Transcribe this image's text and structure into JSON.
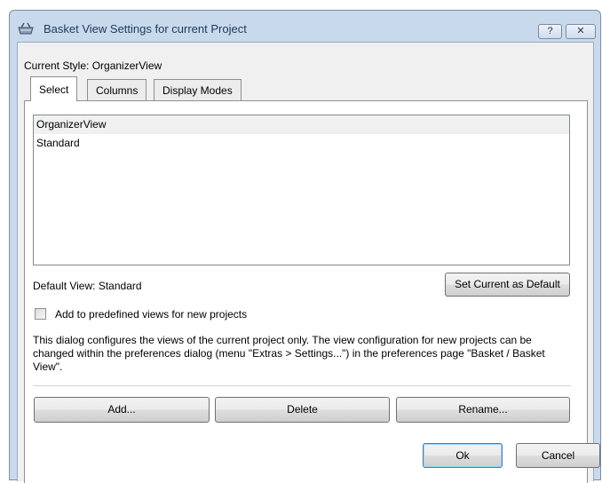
{
  "window": {
    "title": "Basket View Settings for current Project",
    "help_glyph": "?",
    "close_glyph": "✕"
  },
  "current_style": {
    "label": "Current Style:",
    "value": "OrganizerView"
  },
  "tabs": [
    {
      "label": "Select",
      "active": true
    },
    {
      "label": "Columns",
      "active": false
    },
    {
      "label": "Display Modes",
      "active": false
    }
  ],
  "views_list": [
    {
      "label": "OrganizerView",
      "selected": true
    },
    {
      "label": "Standard",
      "selected": false
    }
  ],
  "default_view": {
    "label": "Default View:",
    "value": "Standard"
  },
  "set_default_button": "Set Current as Default",
  "checkbox": {
    "label": "Add to predefined views for new projects",
    "checked": false
  },
  "info_text": "This dialog configures the views of the current project only. The view configuration for new projects can be changed within the preferences dialog (menu \"Extras > Settings...\") in the preferences page \"Basket / Basket View\".",
  "buttons": {
    "add": "Add...",
    "delete": "Delete",
    "rename": "Rename...",
    "ok": "Ok",
    "cancel": "Cancel"
  },
  "colors": {
    "frame": "#c9d9ec",
    "title_text": "#1e395b",
    "panel": "#f0f0f0",
    "default_button_border": "#3c7fb1"
  },
  "icons": {
    "app": "basket-app-icon",
    "help": "help-icon",
    "close": "close-icon"
  }
}
